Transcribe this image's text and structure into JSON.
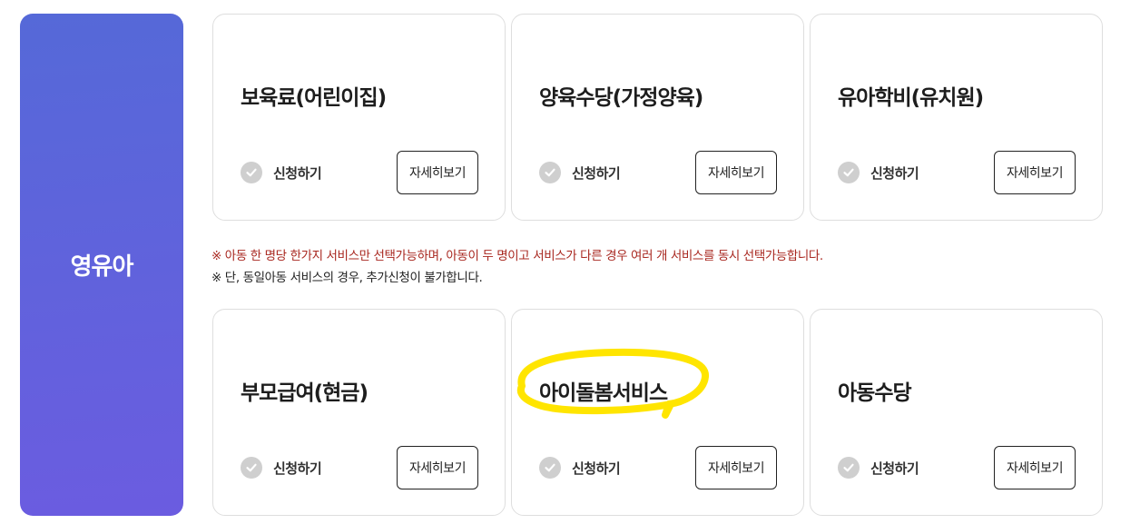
{
  "side_panel": {
    "label": "영유아"
  },
  "cards": [
    {
      "title": "보육료(어린이집)",
      "apply_label": "신청하기",
      "detail_label": "자세히보기"
    },
    {
      "title": "양육수당(가정양육)",
      "apply_label": "신청하기",
      "detail_label": "자세히보기"
    },
    {
      "title": "유아학비(유치원)",
      "apply_label": "신청하기",
      "detail_label": "자세히보기"
    },
    {
      "title": "부모급여(현금)",
      "apply_label": "신청하기",
      "detail_label": "자세히보기"
    },
    {
      "title": "아이돌봄서비스",
      "apply_label": "신청하기",
      "detail_label": "자세히보기"
    },
    {
      "title": "아동수당",
      "apply_label": "신청하기",
      "detail_label": "자세히보기"
    }
  ],
  "notice": {
    "line1": "※ 아동 한 명당 한가지 서비스만 선택가능하며, 아동이 두 명이고 서비스가 다른 경우 여러 개 서비스를 동시 선택가능합니다.",
    "line2": "※ 단, 동일아동 서비스의 경우, 추가신청이 불가합니다."
  },
  "colors": {
    "panel_gradient_start": "#5569d8",
    "panel_gradient_end": "#6b5ce0",
    "notice_red": "#a8271f",
    "highlight": "#ffe500"
  },
  "icons": {
    "apply": "check-circle-icon"
  }
}
